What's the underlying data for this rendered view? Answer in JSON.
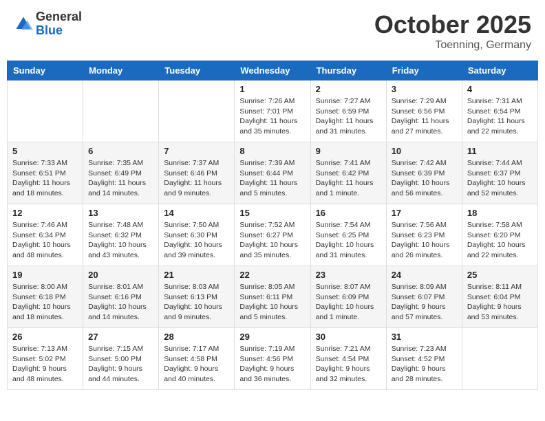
{
  "header": {
    "logo_general": "General",
    "logo_blue": "Blue",
    "month": "October 2025",
    "location": "Toenning, Germany"
  },
  "weekdays": [
    "Sunday",
    "Monday",
    "Tuesday",
    "Wednesday",
    "Thursday",
    "Friday",
    "Saturday"
  ],
  "weeks": [
    [
      {
        "day": "",
        "sunrise": "",
        "sunset": "",
        "daylight": ""
      },
      {
        "day": "",
        "sunrise": "",
        "sunset": "",
        "daylight": ""
      },
      {
        "day": "",
        "sunrise": "",
        "sunset": "",
        "daylight": ""
      },
      {
        "day": "1",
        "sunrise": "Sunrise: 7:26 AM",
        "sunset": "Sunset: 7:01 PM",
        "daylight": "Daylight: 11 hours and 35 minutes."
      },
      {
        "day": "2",
        "sunrise": "Sunrise: 7:27 AM",
        "sunset": "Sunset: 6:59 PM",
        "daylight": "Daylight: 11 hours and 31 minutes."
      },
      {
        "day": "3",
        "sunrise": "Sunrise: 7:29 AM",
        "sunset": "Sunset: 6:56 PM",
        "daylight": "Daylight: 11 hours and 27 minutes."
      },
      {
        "day": "4",
        "sunrise": "Sunrise: 7:31 AM",
        "sunset": "Sunset: 6:54 PM",
        "daylight": "Daylight: 11 hours and 22 minutes."
      }
    ],
    [
      {
        "day": "5",
        "sunrise": "Sunrise: 7:33 AM",
        "sunset": "Sunset: 6:51 PM",
        "daylight": "Daylight: 11 hours and 18 minutes."
      },
      {
        "day": "6",
        "sunrise": "Sunrise: 7:35 AM",
        "sunset": "Sunset: 6:49 PM",
        "daylight": "Daylight: 11 hours and 14 minutes."
      },
      {
        "day": "7",
        "sunrise": "Sunrise: 7:37 AM",
        "sunset": "Sunset: 6:46 PM",
        "daylight": "Daylight: 11 hours and 9 minutes."
      },
      {
        "day": "8",
        "sunrise": "Sunrise: 7:39 AM",
        "sunset": "Sunset: 6:44 PM",
        "daylight": "Daylight: 11 hours and 5 minutes."
      },
      {
        "day": "9",
        "sunrise": "Sunrise: 7:41 AM",
        "sunset": "Sunset: 6:42 PM",
        "daylight": "Daylight: 11 hours and 1 minute."
      },
      {
        "day": "10",
        "sunrise": "Sunrise: 7:42 AM",
        "sunset": "Sunset: 6:39 PM",
        "daylight": "Daylight: 10 hours and 56 minutes."
      },
      {
        "day": "11",
        "sunrise": "Sunrise: 7:44 AM",
        "sunset": "Sunset: 6:37 PM",
        "daylight": "Daylight: 10 hours and 52 minutes."
      }
    ],
    [
      {
        "day": "12",
        "sunrise": "Sunrise: 7:46 AM",
        "sunset": "Sunset: 6:34 PM",
        "daylight": "Daylight: 10 hours and 48 minutes."
      },
      {
        "day": "13",
        "sunrise": "Sunrise: 7:48 AM",
        "sunset": "Sunset: 6:32 PM",
        "daylight": "Daylight: 10 hours and 43 minutes."
      },
      {
        "day": "14",
        "sunrise": "Sunrise: 7:50 AM",
        "sunset": "Sunset: 6:30 PM",
        "daylight": "Daylight: 10 hours and 39 minutes."
      },
      {
        "day": "15",
        "sunrise": "Sunrise: 7:52 AM",
        "sunset": "Sunset: 6:27 PM",
        "daylight": "Daylight: 10 hours and 35 minutes."
      },
      {
        "day": "16",
        "sunrise": "Sunrise: 7:54 AM",
        "sunset": "Sunset: 6:25 PM",
        "daylight": "Daylight: 10 hours and 31 minutes."
      },
      {
        "day": "17",
        "sunrise": "Sunrise: 7:56 AM",
        "sunset": "Sunset: 6:23 PM",
        "daylight": "Daylight: 10 hours and 26 minutes."
      },
      {
        "day": "18",
        "sunrise": "Sunrise: 7:58 AM",
        "sunset": "Sunset: 6:20 PM",
        "daylight": "Daylight: 10 hours and 22 minutes."
      }
    ],
    [
      {
        "day": "19",
        "sunrise": "Sunrise: 8:00 AM",
        "sunset": "Sunset: 6:18 PM",
        "daylight": "Daylight: 10 hours and 18 minutes."
      },
      {
        "day": "20",
        "sunrise": "Sunrise: 8:01 AM",
        "sunset": "Sunset: 6:16 PM",
        "daylight": "Daylight: 10 hours and 14 minutes."
      },
      {
        "day": "21",
        "sunrise": "Sunrise: 8:03 AM",
        "sunset": "Sunset: 6:13 PM",
        "daylight": "Daylight: 10 hours and 9 minutes."
      },
      {
        "day": "22",
        "sunrise": "Sunrise: 8:05 AM",
        "sunset": "Sunset: 6:11 PM",
        "daylight": "Daylight: 10 hours and 5 minutes."
      },
      {
        "day": "23",
        "sunrise": "Sunrise: 8:07 AM",
        "sunset": "Sunset: 6:09 PM",
        "daylight": "Daylight: 10 hours and 1 minute."
      },
      {
        "day": "24",
        "sunrise": "Sunrise: 8:09 AM",
        "sunset": "Sunset: 6:07 PM",
        "daylight": "Daylight: 9 hours and 57 minutes."
      },
      {
        "day": "25",
        "sunrise": "Sunrise: 8:11 AM",
        "sunset": "Sunset: 6:04 PM",
        "daylight": "Daylight: 9 hours and 53 minutes."
      }
    ],
    [
      {
        "day": "26",
        "sunrise": "Sunrise: 7:13 AM",
        "sunset": "Sunset: 5:02 PM",
        "daylight": "Daylight: 9 hours and 48 minutes."
      },
      {
        "day": "27",
        "sunrise": "Sunrise: 7:15 AM",
        "sunset": "Sunset: 5:00 PM",
        "daylight": "Daylight: 9 hours and 44 minutes."
      },
      {
        "day": "28",
        "sunrise": "Sunrise: 7:17 AM",
        "sunset": "Sunset: 4:58 PM",
        "daylight": "Daylight: 9 hours and 40 minutes."
      },
      {
        "day": "29",
        "sunrise": "Sunrise: 7:19 AM",
        "sunset": "Sunset: 4:56 PM",
        "daylight": "Daylight: 9 hours and 36 minutes."
      },
      {
        "day": "30",
        "sunrise": "Sunrise: 7:21 AM",
        "sunset": "Sunset: 4:54 PM",
        "daylight": "Daylight: 9 hours and 32 minutes."
      },
      {
        "day": "31",
        "sunrise": "Sunrise: 7:23 AM",
        "sunset": "Sunset: 4:52 PM",
        "daylight": "Daylight: 9 hours and 28 minutes."
      },
      {
        "day": "",
        "sunrise": "",
        "sunset": "",
        "daylight": ""
      }
    ]
  ]
}
